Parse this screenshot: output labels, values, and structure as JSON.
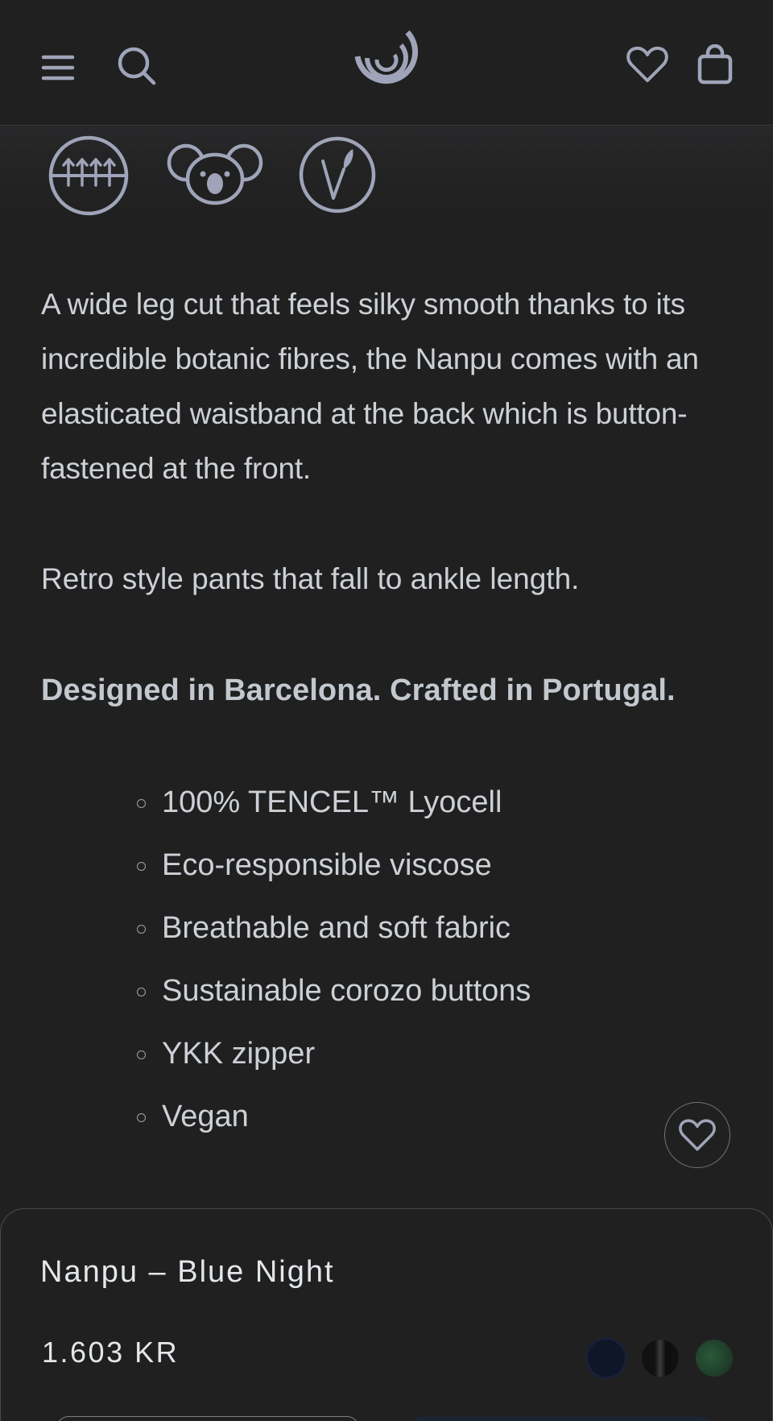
{
  "header": {
    "menu_icon": "hamburger-menu-icon",
    "search_icon": "search-icon",
    "logo_icon": "spiral-logo-icon",
    "wishlist_icon": "heart-icon",
    "bag_icon": "shopping-bag-icon"
  },
  "feature_icons": [
    "breathable-arrows-icon",
    "koala-icon",
    "vegan-leaf-icon"
  ],
  "description": {
    "paragraph": "A wide leg cut that feels silky smooth thanks to its incredible botanic fibres, the Nanpu comes with an elasticated waistband at the back which is button-fastened at the front.",
    "paragraph2": "Retro style pants that fall to ankle length.",
    "tagline": "Designed in Barcelona. Crafted in Portugal."
  },
  "features": [
    "100% TENCEL™ Lyocell",
    "Eco-responsible viscose",
    "Breathable and soft fabric",
    "Sustainable corozo buttons",
    "YKK zipper",
    "Vegan"
  ],
  "product": {
    "name": "Nanpu – Blue Night",
    "price": "1.603 KR",
    "swatches": [
      {
        "name": "Blue Night",
        "color": "#0f1628"
      },
      {
        "name": "Black",
        "color": "#111111"
      },
      {
        "name": "Green",
        "color": "#1f3f2a"
      }
    ]
  },
  "colors": {
    "background": "#202021",
    "text": "#cdd1d6",
    "icon": "#9fa4b8"
  }
}
